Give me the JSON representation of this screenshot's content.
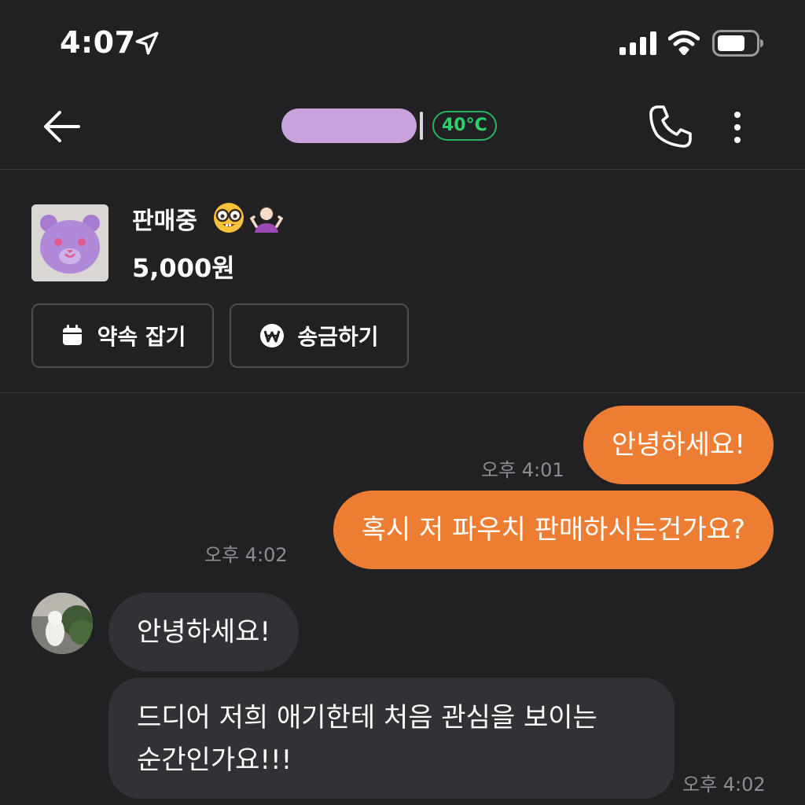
{
  "status_bar": {
    "time": "4:07",
    "icons": [
      "location-arrow-icon",
      "signal-icon",
      "wifi-icon",
      "battery-icon"
    ]
  },
  "nav": {
    "back_icon": "arrow-left-icon",
    "temperature": "40°C",
    "temperature_color": "#2fcf6b",
    "redaction_color": "#c9a1dd",
    "right_icons": [
      "phone-icon",
      "more-vertical-icon"
    ]
  },
  "product": {
    "status": "판매중",
    "emojis": [
      "nerd-face-emoji",
      "person-shrugging-emoji"
    ],
    "price": "5,000원",
    "buttons": [
      {
        "label": "약속 잡기",
        "icon": "calendar-icon"
      },
      {
        "label": "송금하기",
        "icon": "won-coin-icon"
      }
    ]
  },
  "messages": [
    {
      "from": "me",
      "text": "안녕하세요!",
      "time": "오후 4:01"
    },
    {
      "from": "me",
      "text": "혹시 저 파우치 판매하시는건가요?",
      "time": "오후 4:02"
    },
    {
      "from": "them",
      "text": "안녕하세요!",
      "time": ""
    },
    {
      "from": "them",
      "lines": [
        "드디어 저희 애기한테 처음 관심을 보이는",
        "순간인가요!!!"
      ],
      "time": "오후 4:02"
    }
  ],
  "colors": {
    "background": "#212124",
    "my_bubble": "#ee7d34",
    "their_bubble": "#323236",
    "time_text": "#8d8d93"
  }
}
